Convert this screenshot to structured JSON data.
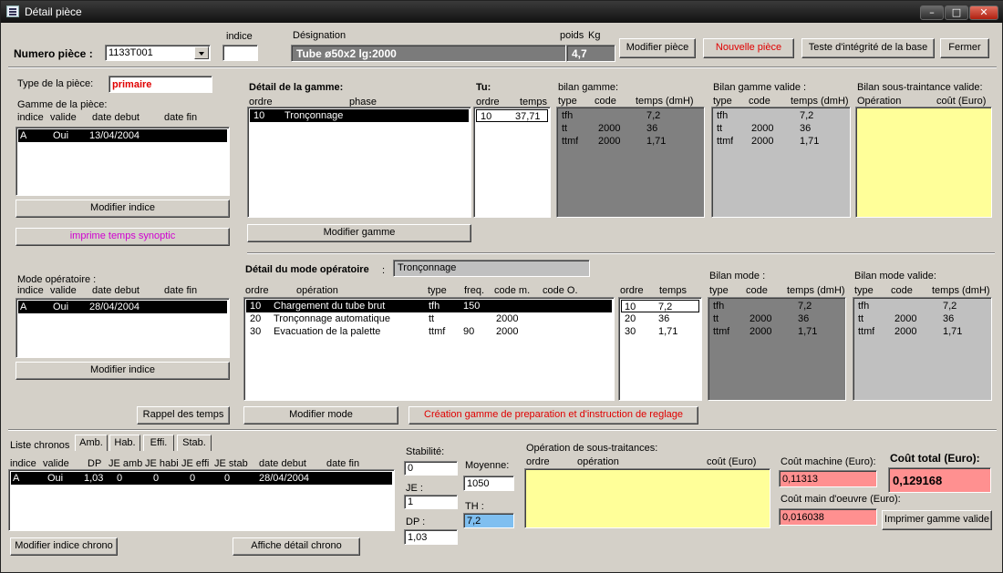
{
  "window": {
    "title": "Détail pièce",
    "minimize": "–",
    "maximize": "□",
    "close": "✕"
  },
  "header": {
    "numero_label": "Numero pièce :",
    "numero_value": "1133T001",
    "indice_label": "indice",
    "indice_value": "",
    "designation_label": "Désignation",
    "designation_value": "Tube ø50x2 lg:2000",
    "poids_label": "poids",
    "kg_label": "Kg",
    "poids_value": "4,7",
    "btn_modifier_piece": "Modifier pièce",
    "btn_nouvelle_piece": "Nouvelle pièce",
    "btn_teste": "Teste d'intégrité de la base",
    "btn_fermer": "Fermer"
  },
  "piece": {
    "type_label": "Type de la pièce:",
    "type_value": "primaire",
    "gamme_label": "Gamme de la pièce:",
    "cols": [
      "indice",
      "valide",
      "date debut",
      "date fin"
    ],
    "rows": [
      [
        "A",
        "Oui",
        "13/04/2004",
        ""
      ]
    ],
    "btn_modifier_indice": "Modifier indice",
    "btn_imprime": "imprime temps synoptic"
  },
  "gamme": {
    "title": "Détail de la gamme:",
    "cols": [
      "ordre",
      "phase"
    ],
    "rows": [
      [
        "10",
        "Tronçonnage"
      ]
    ],
    "btn_modifier": "Modifier gamme"
  },
  "tu": {
    "title": "Tu:",
    "cols": [
      "ordre",
      "temps"
    ],
    "rows": [
      [
        "10",
        "37,71"
      ]
    ]
  },
  "bilan_gamme": {
    "title": "bilan gamme:",
    "cols": [
      "type",
      "code",
      "temps (dmH)"
    ],
    "rows": [
      [
        "tfh",
        "",
        "7,2"
      ],
      [
        "tt",
        "2000",
        "36"
      ],
      [
        "ttmf",
        "2000",
        "1,71"
      ]
    ]
  },
  "bilan_gamme_valide": {
    "title": "Bilan gamme valide :",
    "cols": [
      "type",
      "code",
      "temps (dmH)"
    ],
    "rows": [
      [
        "tfh",
        "",
        "7,2"
      ],
      [
        "tt",
        "2000",
        "36"
      ],
      [
        "ttmf",
        "2000",
        "1,71"
      ]
    ]
  },
  "bilan_st": {
    "title": "Bilan sous-traintance valide:",
    "cols": [
      "Opération",
      "coût (Euro)"
    ]
  },
  "mode": {
    "mode_label": "Mode opératoire :",
    "cols": [
      "indice",
      "valide",
      "date debut",
      "date fin"
    ],
    "rows": [
      [
        "A",
        "Oui",
        "28/04/2004",
        ""
      ]
    ],
    "btn_modifier_indice": "Modifier indice",
    "btn_rappel": "Rappel des temps",
    "detail_title": "Détail du mode opératoire",
    "detail_colon": ":",
    "detail_value": "Tronçonnage",
    "detail_cols": [
      "ordre",
      "opération",
      "type",
      "freq.",
      "code m.",
      "code O."
    ],
    "detail_rows": [
      [
        "10",
        "Chargement du tube brut",
        "tfh",
        "150",
        "",
        ""
      ],
      [
        "20",
        "Tronçonnage automatique",
        "tt",
        "",
        "2000",
        ""
      ],
      [
        "30",
        "Evacuation de la palette",
        "ttmf",
        "90",
        "2000",
        ""
      ]
    ],
    "temps_cols": [
      "ordre",
      "temps"
    ],
    "temps_rows": [
      [
        "10",
        "7,2"
      ],
      [
        "20",
        "36"
      ],
      [
        "30",
        "1,71"
      ]
    ],
    "btn_modifier_mode": "Modifier mode",
    "btn_creation": "Création gamme de preparation et d'instruction de reglage"
  },
  "bilan_mode": {
    "title": "Bilan mode :",
    "cols": [
      "type",
      "code",
      "temps (dmH)"
    ],
    "rows": [
      [
        "tfh",
        "",
        "7,2"
      ],
      [
        "tt",
        "2000",
        "36"
      ],
      [
        "ttmf",
        "2000",
        "1,71"
      ]
    ]
  },
  "bilan_mode_valide": {
    "title": "Bilan mode valide:",
    "cols": [
      "type",
      "code",
      "temps (dmH)"
    ],
    "rows": [
      [
        "tfh",
        "",
        "7,2"
      ],
      [
        "tt",
        "2000",
        "36"
      ],
      [
        "ttmf",
        "2000",
        "1,71"
      ]
    ]
  },
  "chronos": {
    "label": "Liste chronos",
    "tabs": [
      "Amb.",
      "Hab.",
      "Effi.",
      "Stab."
    ],
    "cols": [
      "indice",
      "valide",
      "DP",
      "JE amb",
      "JE habi",
      "JE effi",
      "JE stab",
      "date debut",
      "date fin"
    ],
    "rows": [
      [
        "A",
        "Oui",
        "1,03",
        "0",
        "0",
        "0",
        "0",
        "28/04/2004",
        ""
      ]
    ],
    "btn_modifier": "Modifier indice chrono",
    "btn_affiche": "Affiche détail chrono"
  },
  "stats": {
    "stabilite_label": "Stabilité:",
    "stabilite_value": "0",
    "je_label": "JE :",
    "je_value": "1",
    "dp_label": "DP :",
    "dp_value": "1,03",
    "moyenne_label": "Moyenne:",
    "moyenne_value": "1050",
    "th_label": "TH :",
    "th_value": "7,2"
  },
  "sous_traitances": {
    "title": "Opération de sous-traitances:",
    "cols": [
      "ordre",
      "opération",
      "coût (Euro)"
    ]
  },
  "couts": {
    "machine_label": "Coût machine (Euro):",
    "machine_value": "0,11313",
    "main_label": "Coût main d'oeuvre (Euro):",
    "main_value": "0,016038",
    "total_label": "Coût total (Euro):",
    "total_value": "0,129168",
    "btn_imprimer": "Imprimer gamme valide"
  }
}
